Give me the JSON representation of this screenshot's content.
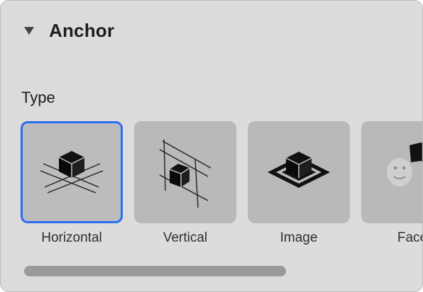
{
  "section": {
    "title": "Anchor",
    "expanded": true
  },
  "type_label": "Type",
  "anchor_types": [
    {
      "label": "Horizontal",
      "icon": "horizontal-plane-cube-icon",
      "selected": true
    },
    {
      "label": "Vertical",
      "icon": "vertical-plane-cube-icon",
      "selected": false
    },
    {
      "label": "Image",
      "icon": "image-target-cube-icon",
      "selected": false
    },
    {
      "label": "Face",
      "icon": "face-icon",
      "selected": false
    }
  ],
  "colors": {
    "panel_bg": "#dcdcdc",
    "tile_bg": "#b9b9b9",
    "selection_accent": "#2a6ef0"
  }
}
